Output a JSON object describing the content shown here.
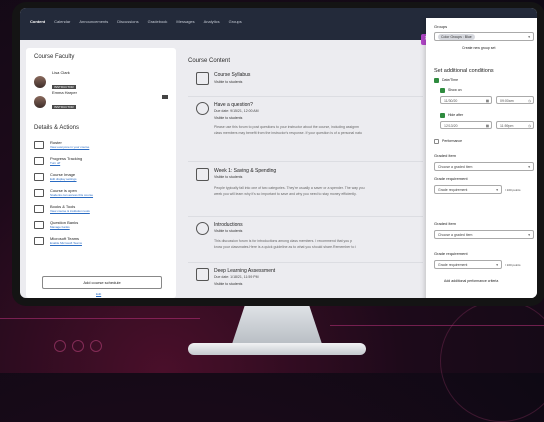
{
  "nav": {
    "tabs": [
      "Content",
      "Calendar",
      "Announcements",
      "Discussions",
      "Gradebook",
      "Messages",
      "Analytics",
      "Groups"
    ]
  },
  "faculty": {
    "heading": "Course Faculty",
    "people": [
      {
        "name": "Lisa Clark",
        "role": "INSTRUCTOR"
      },
      {
        "name": "Emma Harper",
        "role": "INSTRUCTOR"
      }
    ]
  },
  "details": {
    "heading": "Details & Actions",
    "items": [
      {
        "name": "Roster",
        "link": "View everyone in your course"
      },
      {
        "name": "Progress Tracking",
        "link": "Turn off"
      },
      {
        "name": "Course Image",
        "link": "Edit display settings"
      },
      {
        "name": "Course is open",
        "link": "Students can access this course"
      },
      {
        "name": "Books & Tools",
        "link": "View course & institution tools"
      },
      {
        "name": "Question Banks",
        "link": "Manage banks"
      },
      {
        "name": "Microsoft Teams",
        "link": "Enable Microsoft Teams"
      }
    ],
    "schedule_button": "Add course schedule",
    "edit_link": "Edit"
  },
  "content": {
    "heading": "Course Content",
    "items": [
      {
        "title": "Course Syllabus",
        "sub": "",
        "visibility": "Visible to students",
        "desc": ""
      },
      {
        "title": "Have a question?",
        "sub": "Due date: 9/15/21, 12:00 AM",
        "visibility": "Visible to students",
        "desc": "Please use this forum to post questions to your instructor about the course, including assignm",
        "desc2": "class members may benefit from the instructor's response. If your question is of a personal natu"
      },
      {
        "title": "Week 1: Saving & Spending",
        "sub": "",
        "visibility": "Visible to students",
        "desc": "People typically fall into one of two categories. They're usually a saver or a spender. The way you",
        "desc2": "week you will learn why it's so important to save and why you need to stay money efficiently."
      },
      {
        "title": "Introductions",
        "sub": "",
        "visibility": "Visible to students",
        "desc": "This discussion forum is for introductions among class members. I recommend that you p",
        "desc2": "know your classmates.Here is a quick guideline as to what you should share.Remember to i"
      },
      {
        "title": "Deep Learning Assessment",
        "sub": "Due date: 1/18/21, 11:59 PM",
        "visibility": "Visible to students",
        "desc": ""
      }
    ]
  },
  "panel": {
    "groups_label": "Groups",
    "groups_chip": "Color Groups : Blue",
    "create_group": "Create new group set",
    "conditions_heading": "Set additional conditions",
    "datetime_label": "Date/Time",
    "show_on_label": "Show on",
    "show_on_date": "11/30/20",
    "show_on_time": "09:00am",
    "hide_after_label": "Hide after",
    "hide_after_date": "12/13/20",
    "hide_after_time": "11:59pm",
    "performance_label": "Performance",
    "graded_item_label": "Graded item",
    "graded_item_placeholder": "Choose a graded item",
    "grade_req_label": "Grade requirement",
    "grade_req_placeholder": "Grade requirement",
    "points_suffix": "/ 100 points",
    "add_criteria": "Add additional performance criteria"
  }
}
